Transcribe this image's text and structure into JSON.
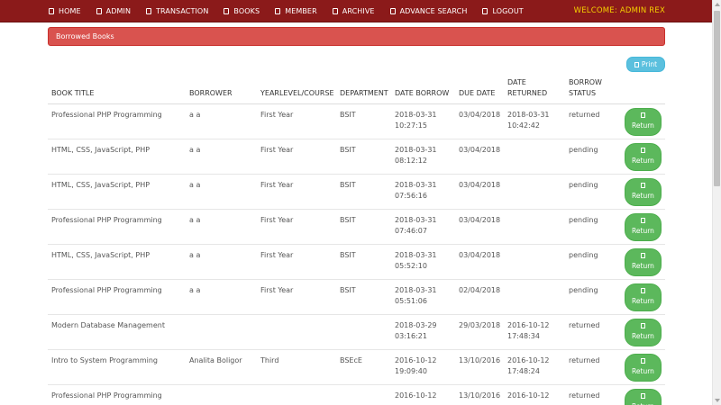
{
  "nav": {
    "items": [
      {
        "label": "HOME",
        "icon": "home-icon"
      },
      {
        "label": "ADMIN",
        "icon": "user-icon"
      },
      {
        "label": "TRANSACTION",
        "icon": "exchange-icon"
      },
      {
        "label": "BOOKS",
        "icon": "book-icon"
      },
      {
        "label": "MEMBER",
        "icon": "users-icon"
      },
      {
        "label": "ARCHIVE",
        "icon": "archive-icon"
      },
      {
        "label": "ADVANCE SEARCH",
        "icon": "search-icon"
      },
      {
        "label": "LOGOUT",
        "icon": "logout-icon"
      }
    ],
    "welcome": "WELCOME: ADMIN REX"
  },
  "panel": {
    "title": "Borrowed Books"
  },
  "print": {
    "label": "Print"
  },
  "table": {
    "headers": [
      "BOOK TITLE",
      "BORROWER",
      "YEARLEVEL/COURSE",
      "DEPARTMENT",
      "DATE BORROW",
      "DUE DATE",
      "DATE RETURNED",
      "BORROW STATUS"
    ],
    "return_label": "Return",
    "rows": [
      {
        "title": "Professional PHP Programming",
        "borrower": "a a",
        "year": "First Year",
        "dept": "BSIT",
        "borrow": "2018-03-31 10:27:15",
        "due": "03/04/2018",
        "returned": "2018-03-31 10:42:42",
        "status": "returned"
      },
      {
        "title": "HTML, CSS, JavaScript, PHP",
        "borrower": "a a",
        "year": "First Year",
        "dept": "BSIT",
        "borrow": "2018-03-31 08:12:12",
        "due": "03/04/2018",
        "returned": "",
        "status": "pending"
      },
      {
        "title": "HTML, CSS, JavaScript, PHP",
        "borrower": "a a",
        "year": "First Year",
        "dept": "BSIT",
        "borrow": "2018-03-31 07:56:16",
        "due": "03/04/2018",
        "returned": "",
        "status": "pending"
      },
      {
        "title": "Professional PHP Programming",
        "borrower": "a a",
        "year": "First Year",
        "dept": "BSIT",
        "borrow": "2018-03-31 07:46:07",
        "due": "03/04/2018",
        "returned": "",
        "status": "pending"
      },
      {
        "title": "HTML, CSS, JavaScript, PHP",
        "borrower": "a a",
        "year": "First Year",
        "dept": "BSIT",
        "borrow": "2018-03-31 05:52:10",
        "due": "03/04/2018",
        "returned": "",
        "status": "pending"
      },
      {
        "title": "Professional PHP Programming",
        "borrower": "a a",
        "year": "First Year",
        "dept": "BSIT",
        "borrow": "2018-03-31 05:51:06",
        "due": "02/04/2018",
        "returned": "",
        "status": "pending"
      },
      {
        "title": "Modern Database Management",
        "borrower": "",
        "year": "",
        "dept": "",
        "borrow": "2018-03-29 03:16:21",
        "due": "29/03/2018",
        "returned": "2016-10-12 17:48:34",
        "status": "returned"
      },
      {
        "title": "Intro to System Programming",
        "borrower": "Analita Boligor",
        "year": "Third",
        "dept": "BSEcE",
        "borrow": "2016-10-12 19:09:40",
        "due": "13/10/2016",
        "returned": "2016-10-12 17:48:24",
        "status": "returned"
      },
      {
        "title": "Professional PHP Programming",
        "borrower": "",
        "year": "",
        "dept": "",
        "borrow": "2016-10-12",
        "due": "13/10/2016",
        "returned": "2016-10-12",
        "status": "returned"
      }
    ]
  }
}
